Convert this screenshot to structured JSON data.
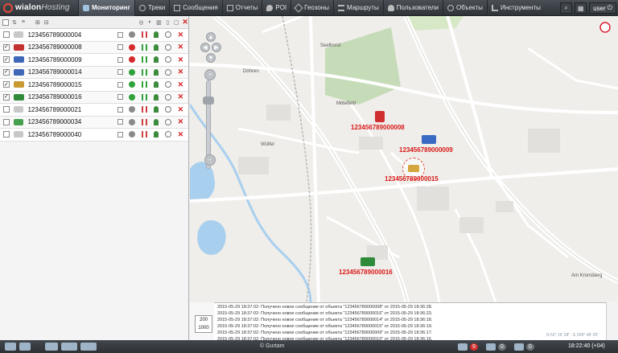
{
  "app": {
    "logo_brand": "wialon",
    "logo_suffix": "Hosting"
  },
  "nav": {
    "tabs": [
      {
        "label": "Мониторинг",
        "active": true,
        "icon": "monitoring-icon"
      },
      {
        "label": "Треки",
        "icon": "tracks-icon"
      },
      {
        "label": "Сообщения",
        "icon": "messages-icon"
      },
      {
        "label": "Отчеты",
        "icon": "reports-icon"
      },
      {
        "label": "POI",
        "icon": "poi-icon"
      },
      {
        "label": "Геозоны",
        "icon": "geofence-icon"
      },
      {
        "label": "Маршруты",
        "icon": "routes-icon"
      },
      {
        "label": "Пользователи",
        "icon": "users-icon"
      },
      {
        "label": "Объекты",
        "icon": "units-icon"
      },
      {
        "label": "Инструменты",
        "icon": "tools-icon"
      }
    ],
    "user": "user"
  },
  "units": [
    {
      "name": "123456789000004",
      "checked": false,
      "vehicle": "#c8c8c8",
      "motion": "#8a8a8a",
      "bars": "#cf3f3f"
    },
    {
      "name": "123456789000008",
      "checked": true,
      "vehicle": "#c43030",
      "motion": "#d42a2a",
      "bars": "#2fa33a"
    },
    {
      "name": "123456789000009",
      "checked": true,
      "vehicle": "#3f67b8",
      "motion": "#d42a2a",
      "bars": "#2fa33a"
    },
    {
      "name": "123456789000014",
      "checked": true,
      "vehicle": "#3f67b8",
      "motion": "#2fa33a",
      "bars": "#2fa33a"
    },
    {
      "name": "123456789000015",
      "checked": true,
      "vehicle": "#c89a32",
      "motion": "#2fa33a",
      "bars": "#2fa33a"
    },
    {
      "name": "123456789000016",
      "checked": true,
      "vehicle": "#2f8a3a",
      "motion": "#2fa33a",
      "bars": "#2fa33a"
    },
    {
      "name": "123456789000021",
      "checked": false,
      "vehicle": "#c8c8c8",
      "motion": "#8a8a8a",
      "bars": "#cf3f3f"
    },
    {
      "name": "123456789000034",
      "checked": false,
      "vehicle": "#47a04f",
      "motion": "#8a8a8a",
      "bars": "#cf3f3f"
    },
    {
      "name": "123456789000040",
      "checked": false,
      "vehicle": "#c8c8c8",
      "motion": "#8a8a8a",
      "bars": "#cf3f3f"
    }
  ],
  "map": {
    "labels": {
      "u8": "123456789000008",
      "u9": "123456789000009",
      "u15": "123456789000015",
      "u16": "123456789000016"
    },
    "places": {
      "seelhorst": "Seelhorst",
      "dohren": "Döhren",
      "mittelfeld": "Mittelfeld",
      "wulfel": "Wülfel",
      "amkronsberg": "Am Kronsberg"
    }
  },
  "scale": {
    "top": "200",
    "unit": "m",
    "bottom": "1000"
  },
  "log": [
    "2015-05-29 18:37:02: Получено новое сообщение от объекта \"123456789000008\" от 2015-05-29 18:36:28.",
    "2015-05-29 18:37:02: Получено новое сообщение от объекта \"123456789000016\" от 2015-05-29 18:36:23.",
    "2015-05-29 18:37:02: Получено новое сообщение от объекта \"123456789000014\" от 2015-05-29 18:36:18.",
    "2015-05-29 18:37:02: Получено новое сообщение от объекта \"123456789000015\" от 2015-05-29 18:36:19.",
    "2015-05-29 18:37:02: Получено новое сообщение от объекта \"123456789000009\" от 2015-05-29 18:36:17.",
    "2015-05-29 18:37:02: Получено новое сообщение от объекта \"123456789000010\" от 2015-05-29 18:36:16."
  ],
  "coords": "N 52° 16' 28\" : E 009° 48' 05\"",
  "footer": {
    "copyright": "© Gurtam",
    "badge_notifications": "9",
    "badge_b": "0",
    "badge_c": "0",
    "clock": "18:22:40 (+04)"
  }
}
